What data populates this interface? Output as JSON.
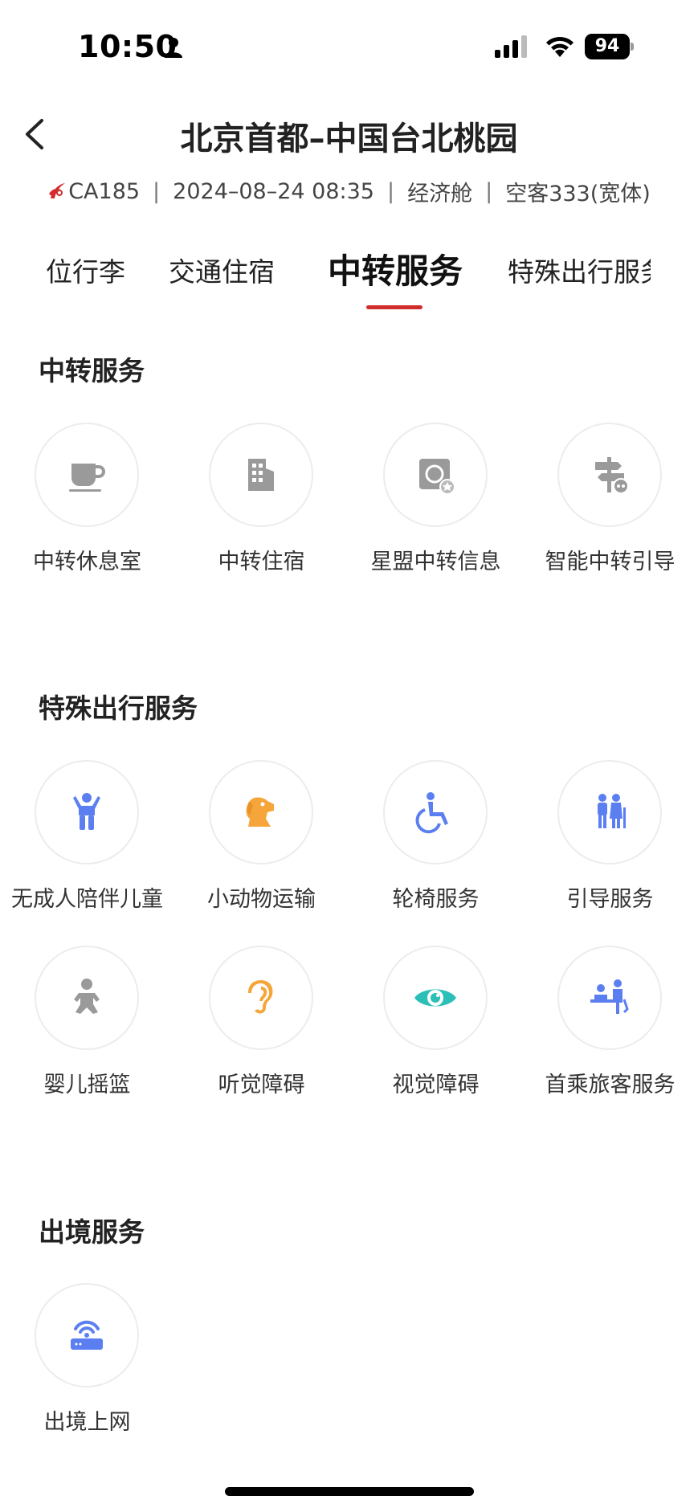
{
  "status_bar": {
    "time": "10:50",
    "battery": "94"
  },
  "header": {
    "title": "北京首都–中国台北桃园",
    "flight_no": "CA185",
    "datetime": "2024–08–24 08:35",
    "cabin": "经济舱",
    "aircraft": "空客333(宽体)",
    "separator": "|"
  },
  "tabs": [
    {
      "label": "位行李",
      "active": false
    },
    {
      "label": "交通住宿",
      "active": false
    },
    {
      "label": "中转服务",
      "active": true
    },
    {
      "label": "特殊出行服务",
      "active": false
    }
  ],
  "sections": [
    {
      "title": "中转服务",
      "items": [
        {
          "label": "中转休息室",
          "icon": "coffee-cup-icon",
          "color": "#9a9a9a"
        },
        {
          "label": "中转住宿",
          "icon": "building-icon",
          "color": "#9a9a9a"
        },
        {
          "label": "星盟中转信息",
          "icon": "star-alliance-icon",
          "color": "#9a9a9a"
        },
        {
          "label": "智能中转引导",
          "icon": "signpost-icon",
          "color": "#9a9a9a"
        }
      ]
    },
    {
      "title": "特殊出行服务",
      "items": [
        {
          "label": "无成人陪伴儿童",
          "icon": "child-icon",
          "color": "#5b7ff0"
        },
        {
          "label": "小动物运输",
          "icon": "dog-icon",
          "color": "#f5a53a"
        },
        {
          "label": "轮椅服务",
          "icon": "wheelchair-icon",
          "color": "#5b7ff0"
        },
        {
          "label": "引导服务",
          "icon": "elderly-couple-icon",
          "color": "#5b7ff0"
        },
        {
          "label": "婴儿摇篮",
          "icon": "baby-icon",
          "color": "#9a9a9a"
        },
        {
          "label": "听觉障碍",
          "icon": "ear-icon",
          "color": "#f5a53a"
        },
        {
          "label": "视觉障碍",
          "icon": "eye-icon",
          "color": "#2bbfb8"
        },
        {
          "label": "首乘旅客服务",
          "icon": "first-flight-icon",
          "color": "#5b7ff0"
        }
      ]
    },
    {
      "title": "出境服务",
      "items": [
        {
          "label": "出境上网",
          "icon": "wifi-router-icon",
          "color": "#5b7ff0"
        }
      ]
    }
  ],
  "colors": {
    "accent": "#d22d2d",
    "primary_blue": "#5b7ff0",
    "orange": "#f5a53a",
    "teal": "#2bbfb8",
    "gray_icon": "#9a9a9a"
  }
}
